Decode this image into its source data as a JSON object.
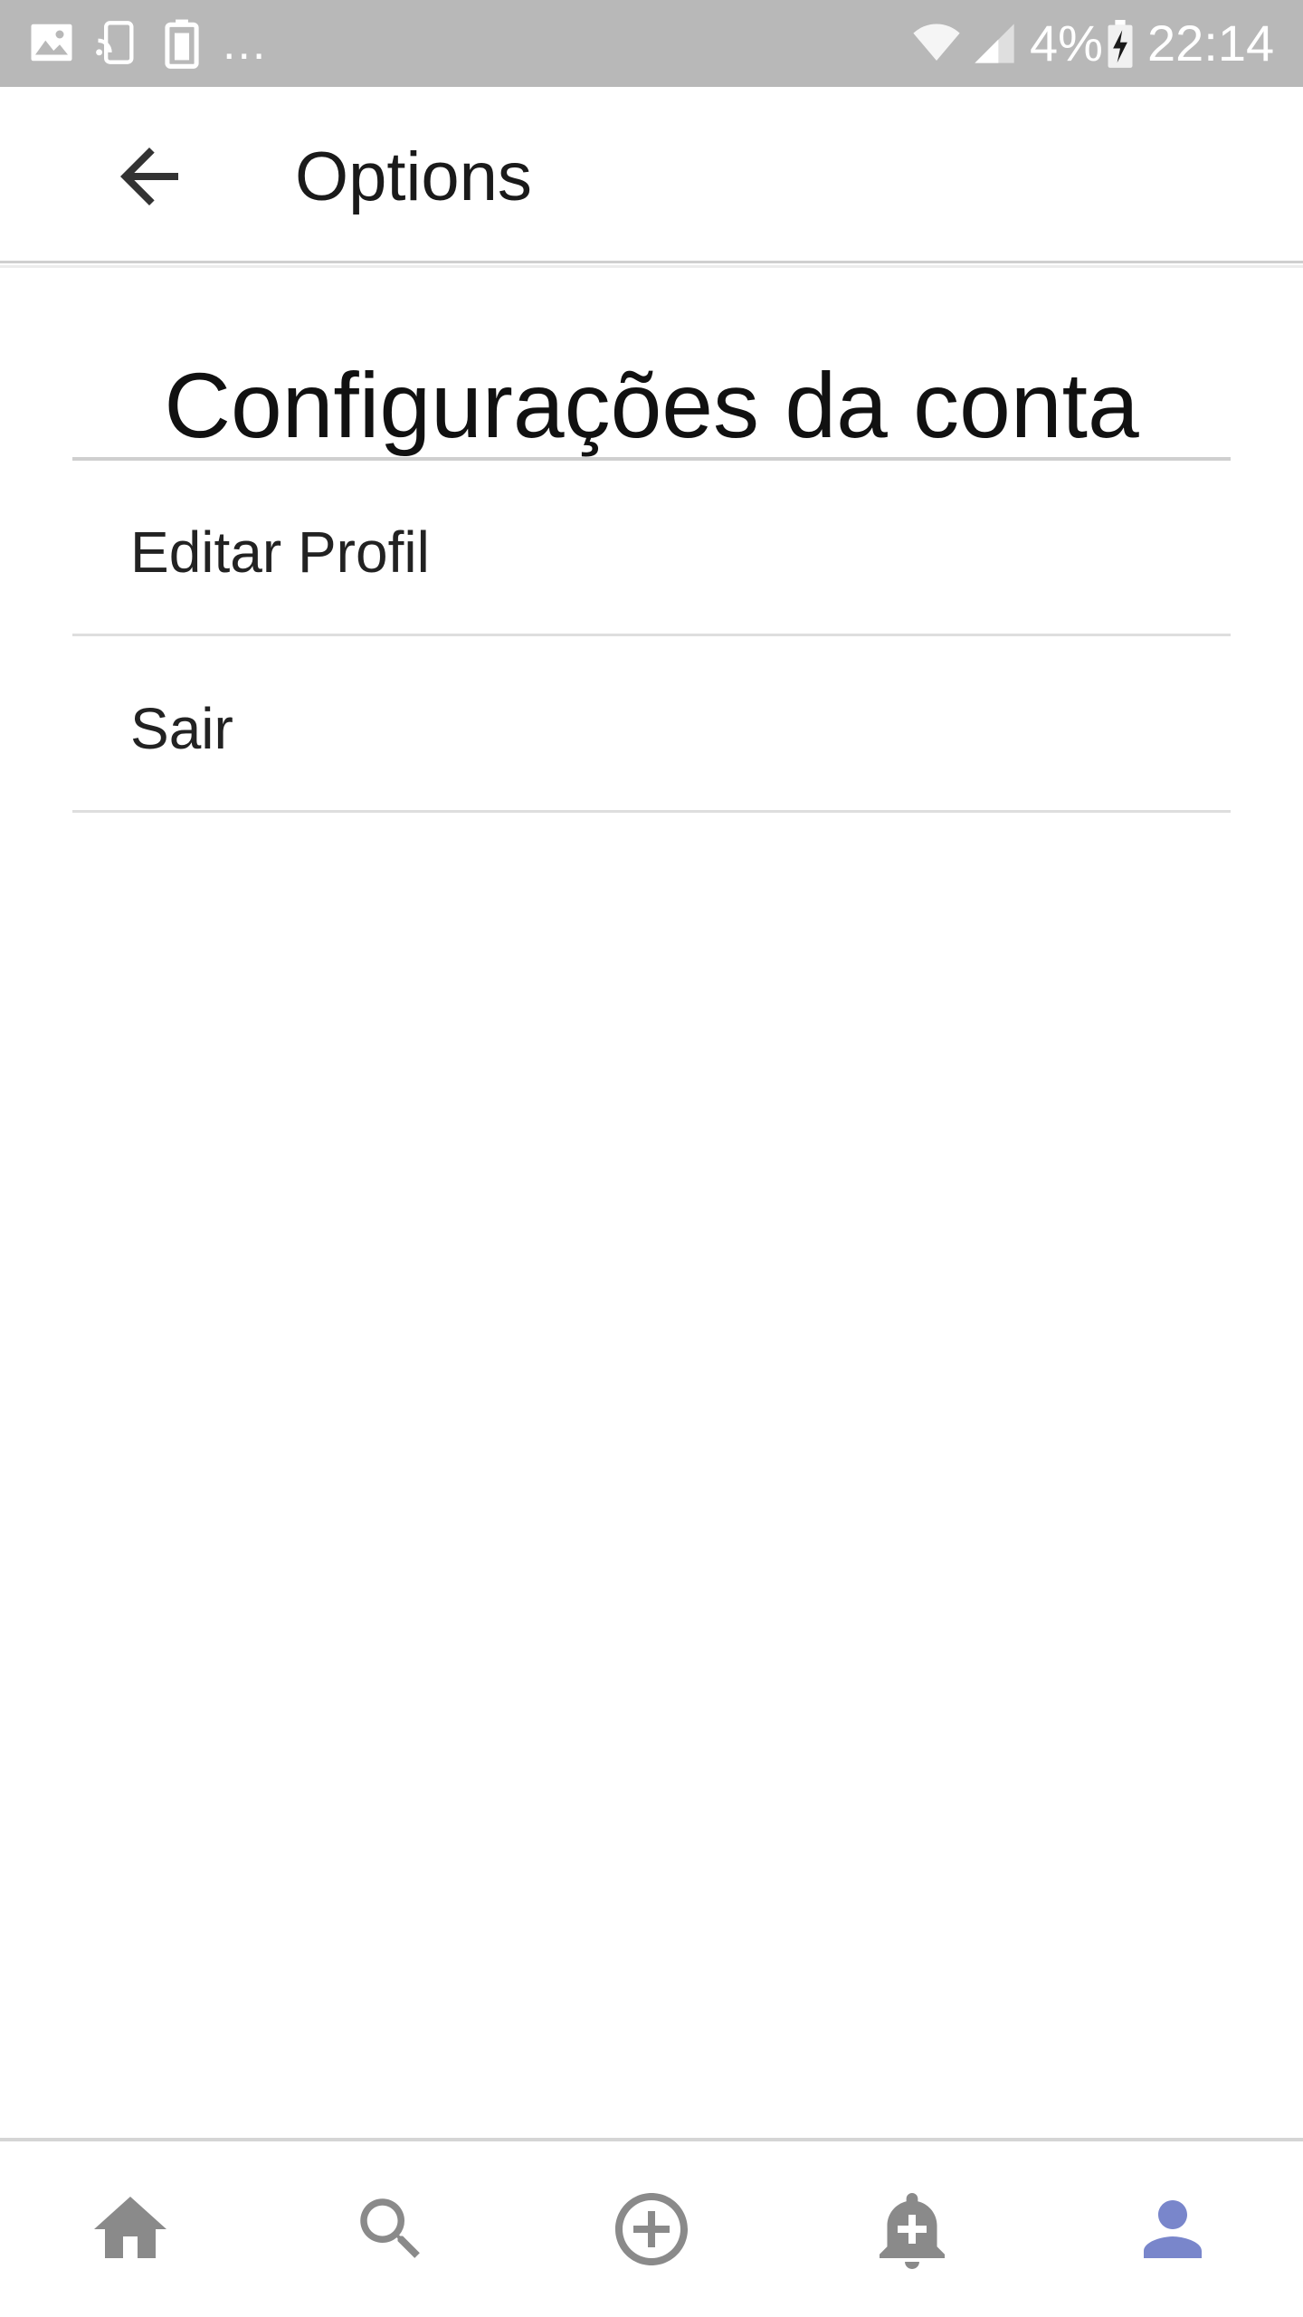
{
  "status_bar": {
    "left_icons": [
      "image-icon",
      "screen-mirror-icon",
      "battery-saver-icon"
    ],
    "more_indicator": "...",
    "battery_percent": "4%",
    "time": "22:14"
  },
  "app_bar": {
    "back_icon": "arrow-back-icon",
    "title": "Options"
  },
  "section": {
    "title": "Configurações da conta"
  },
  "menu": {
    "items": [
      {
        "label": "Editar Profil"
      },
      {
        "label": "Sair"
      }
    ]
  },
  "bottom_nav": {
    "items": [
      {
        "icon": "home-icon",
        "active": false
      },
      {
        "icon": "search-icon",
        "active": false
      },
      {
        "icon": "add-circle-icon",
        "active": false
      },
      {
        "icon": "add-alert-icon",
        "active": false
      },
      {
        "icon": "person-icon",
        "active": true
      }
    ],
    "inactive_color": "#8a8a8a",
    "active_color": "#7986cb"
  }
}
